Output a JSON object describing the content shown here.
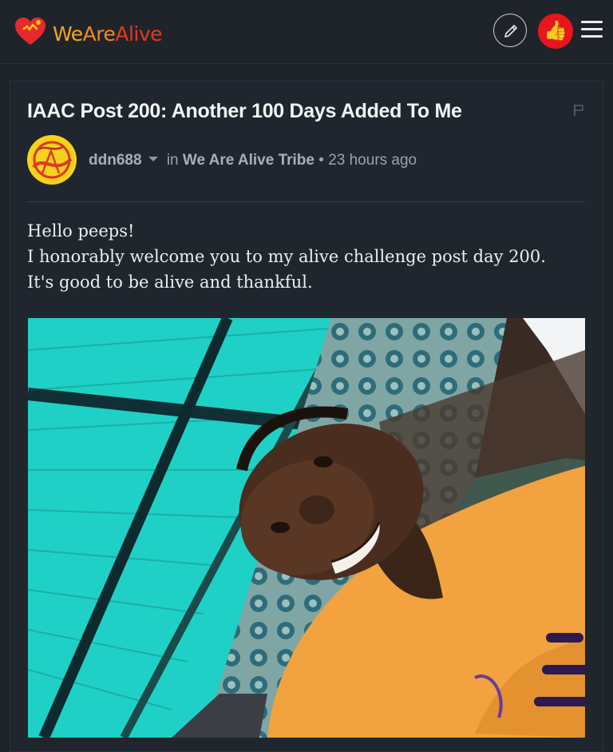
{
  "app": {
    "logo_we": "We",
    "logo_are": "Are",
    "logo_alive": "Alive",
    "brand_colors": {
      "primary_red": "#e53a1e",
      "orange": "#f28a1f",
      "yellow": "#f2a61f"
    }
  },
  "header": {
    "edit_icon": "pencil-icon",
    "like_icon": "thumbs-up-icon",
    "like_glyph": "👍",
    "menu_icon": "hamburger-menu-icon"
  },
  "post": {
    "title": "IAAC Post 200: Another 100 Days Added To Me",
    "author": "ddn688",
    "in_label": "in",
    "community": "We Are Alive Tribe",
    "separator": "•",
    "timestamp": "23 hours ago",
    "body_lines": [
      "Hello peeps!",
      "I honorably welcome you to my alive challenge post day 200.",
      "It's good to be alive and thankful."
    ]
  }
}
